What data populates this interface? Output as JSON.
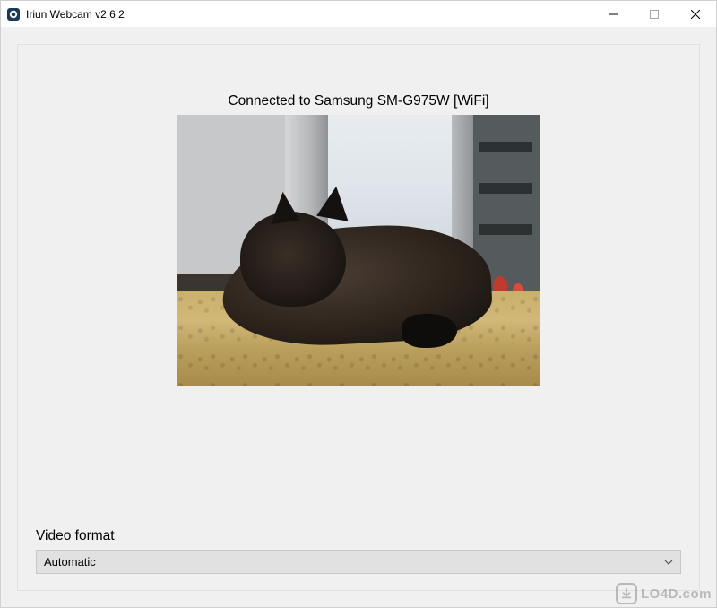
{
  "window": {
    "title": "Iriun Webcam v2.6.2"
  },
  "status": {
    "connected_text": "Connected to Samsung SM-G975W [WiFi]"
  },
  "video_format": {
    "label": "Video format",
    "selected": "Automatic"
  },
  "watermark": {
    "text": "LO4D.com"
  }
}
